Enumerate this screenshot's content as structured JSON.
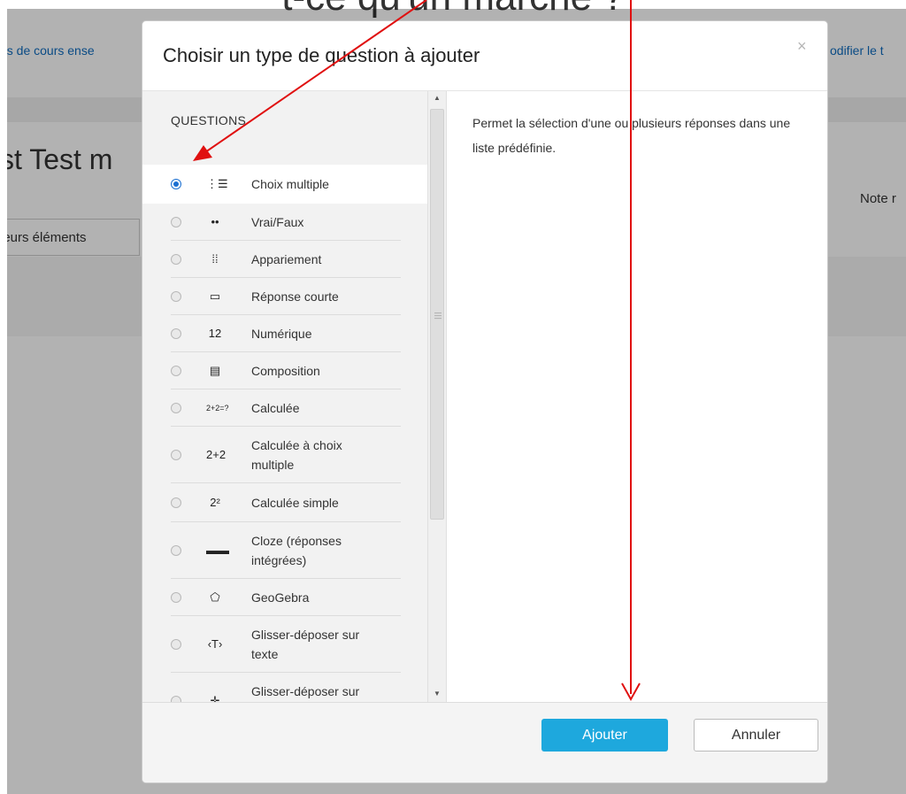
{
  "background": {
    "title": "t-ce qu'un marché ?",
    "link_left": "es de cours ense",
    "link_right": "odifier le t",
    "test_heading": "st Test m",
    "note": "Note r",
    "tab": "ieurs éléments"
  },
  "dialog": {
    "title": "Choisir un type de question à ajouter",
    "close_symbol": "×",
    "section_heading": "QUESTIONS",
    "selected_index": 0,
    "options": [
      {
        "label": "Choix multiple",
        "icon": "multichoice-icon",
        "glyph": "⋮☰"
      },
      {
        "label": "Vrai/Faux",
        "icon": "truefalse-icon",
        "glyph": "••"
      },
      {
        "label": "Appariement",
        "icon": "match-icon",
        "glyph": "⁞⁞"
      },
      {
        "label": "Réponse courte",
        "icon": "shortanswer-icon",
        "glyph": "▭"
      },
      {
        "label": "Numérique",
        "icon": "numerical-icon",
        "glyph": "12"
      },
      {
        "label": "Composition",
        "icon": "essay-icon",
        "glyph": "▤"
      },
      {
        "label": "Calculée",
        "icon": "calculated-icon",
        "glyph": "2+2=?"
      },
      {
        "label": "Calculée à choix multiple",
        "icon": "calculatedmulti-icon",
        "glyph": "2+2"
      },
      {
        "label": "Calculée simple",
        "icon": "calculatedsimple-icon",
        "glyph": "2²"
      },
      {
        "label": "Cloze (réponses intégrées)",
        "icon": "cloze-icon",
        "glyph": "▬▬"
      },
      {
        "label": "GeoGebra",
        "icon": "geogebra-icon",
        "glyph": "⬠"
      },
      {
        "label": "Glisser-déposer sur texte",
        "icon": "ddwtos-icon",
        "glyph": "‹T›"
      },
      {
        "label": "Glisser-déposer sur une image",
        "icon": "ddimage-icon",
        "glyph": "✛"
      }
    ],
    "description": "Permet la sélection d'une ou plusieurs réponses dans une liste prédéfinie.",
    "add_label": "Ajouter",
    "cancel_label": "Annuler"
  },
  "colors": {
    "accent": "#1ea8dd",
    "annotation": "#e01010",
    "radio_selected": "#1b6fd1"
  }
}
